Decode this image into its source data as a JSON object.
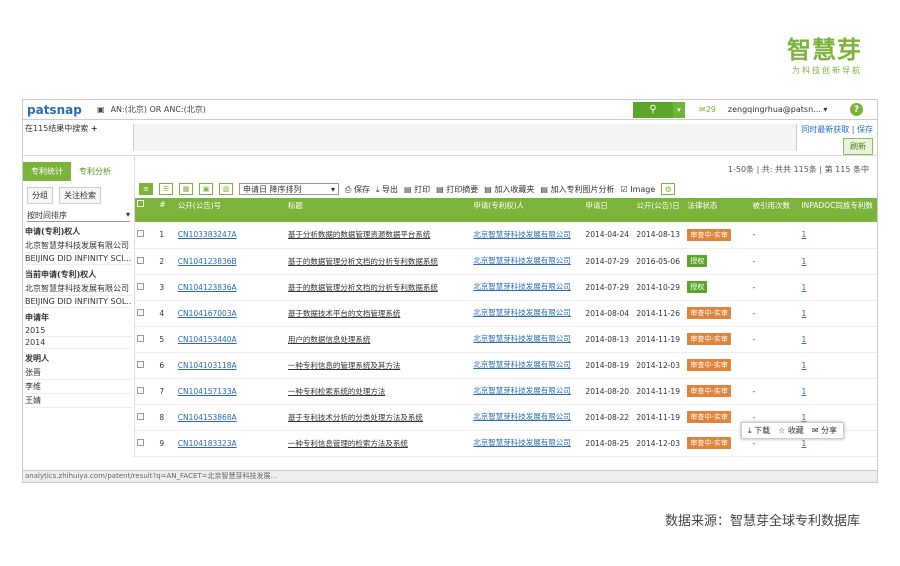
{
  "brand": {
    "logo": "智慧芽",
    "slogan": "为科技创新导航"
  },
  "topbar": {
    "logo": "patsnap",
    "query": "AN:(北京) OR ANC:(北京)",
    "user_msg": "29",
    "user": "zengqingrhua@patsn..."
  },
  "header2": {
    "left_text": "在115结果中搜索",
    "right_link": "同时最新获取 | 保存",
    "right_button": "刷新"
  },
  "side": {
    "tabs": [
      "专利统计",
      "专利分析"
    ],
    "subtabs": [
      "分组",
      "关注检索"
    ],
    "select": "按时间排序",
    "sections": [
      {
        "heading": "申请(专利)权人",
        "items": [
          "北京智慧芽科技发展有限公司",
          "BEIJING DID INFINITY SCI..."
        ]
      },
      {
        "heading": "当前申请(专利)权人",
        "items": [
          "北京智慧芽科技发展有限公司",
          "BEIJING DID INFINITY SOL..."
        ]
      },
      {
        "heading": "申请年",
        "items": [
          "2015",
          "2014"
        ]
      },
      {
        "heading": "发明人",
        "items": [
          "张晋",
          "李维",
          "王婧"
        ]
      }
    ]
  },
  "content": {
    "pageinfo": "1-50条 | 共: 共共 115条 | 第 115 条中",
    "toolbar": {
      "sort": "申请日 降序排列",
      "actions": [
        "保存",
        "导出",
        "打印",
        "打印摘要",
        "加入收藏夹",
        "加入专利图片分析",
        "Image"
      ]
    },
    "columns": [
      "#",
      "#",
      "公开(公告)号",
      "标题",
      "申请(专利权)人",
      "申请日",
      "公开(公告)日",
      "法律状态",
      "被引用次数",
      "INPADOC同族专利数"
    ],
    "rows": [
      {
        "n": "1",
        "pn": "CN103383247A",
        "title": "基于分析数据的数据管理资源数据平台系统",
        "ap": "北京智慧芽科技发展有限公司",
        "ad": "2014-04-24",
        "pd": "2014-08-13",
        "st": "审查中-实审",
        "stc": "o",
        "cited": "-",
        "fam": "1"
      },
      {
        "n": "2",
        "pn": "CN104123836B",
        "title": "基于的数据管理分析文档的分析专利数据系统",
        "ap": "北京智慧芽科技发展有限公司",
        "ad": "2014-07-29",
        "pd": "2016-05-06",
        "st": "授权",
        "stc": "g",
        "cited": "-",
        "fam": "1"
      },
      {
        "n": "3",
        "pn": "CN104123836A",
        "title": "基于的数据管理分析文档的分析专利数据系统",
        "ap": "北京智慧芽科技发展有限公司",
        "ad": "2014-07-29",
        "pd": "2014-10-29",
        "st": "授权",
        "stc": "g",
        "cited": "-",
        "fam": "1"
      },
      {
        "n": "4",
        "pn": "CN104167003A",
        "title": "基于数据技术平台的文档管理系统",
        "ap": "北京智慧芽科技发展有限公司",
        "ad": "2014-08-04",
        "pd": "2014-11-26",
        "st": "审查中-实审",
        "stc": "o",
        "cited": "-",
        "fam": "1"
      },
      {
        "n": "5",
        "pn": "CN104153440A",
        "title": "用户的数据信息处理系统",
        "ap": "北京智慧芽科技发展有限公司",
        "ad": "2014-08-13",
        "pd": "2014-11-19",
        "st": "审查中-实审",
        "stc": "o",
        "cited": "-",
        "fam": "1"
      },
      {
        "n": "6",
        "pn": "CN104103118A",
        "title": "一种专利信息的管理系统及其方法",
        "ap": "北京智慧芽科技发展有限公司",
        "ad": "2014-08-19",
        "pd": "2014-12-03",
        "st": "审查中-实审",
        "stc": "o",
        "cited": "",
        "fam": "1"
      },
      {
        "n": "7",
        "pn": "CN104157133A",
        "title": "一种专利检索系统的处理方法",
        "ap": "北京智慧芽科技发展有限公司",
        "ad": "2014-08-20",
        "pd": "2014-11-19",
        "st": "审查中-实审",
        "stc": "o",
        "cited": "-",
        "fam": "1"
      },
      {
        "n": "8",
        "pn": "CN104153868A",
        "title": "基于专利技术分析的分类处理方法及系统",
        "ap": "北京智慧芽科技发展有限公司",
        "ad": "2014-08-22",
        "pd": "2014-11-19",
        "st": "审查中-实审",
        "stc": "o",
        "cited": "-",
        "fam": "1"
      },
      {
        "n": "9",
        "pn": "CN104183323A",
        "title": "一种专利信息管理的检索方法及系统",
        "ap": "北京智慧芽科技发展有限公司",
        "ad": "2014-08-25",
        "pd": "2014-12-03",
        "st": "审查中-实审",
        "stc": "o",
        "cited": "-",
        "fam": "1"
      }
    ],
    "popup": [
      "下载",
      "收藏",
      "分享"
    ],
    "status": "analytics.zhihuiya.com/patent/result?q=AN_FACET=北京智慧芽科技发展..."
  },
  "source": "数据来源：智慧芽全球专利数据库"
}
